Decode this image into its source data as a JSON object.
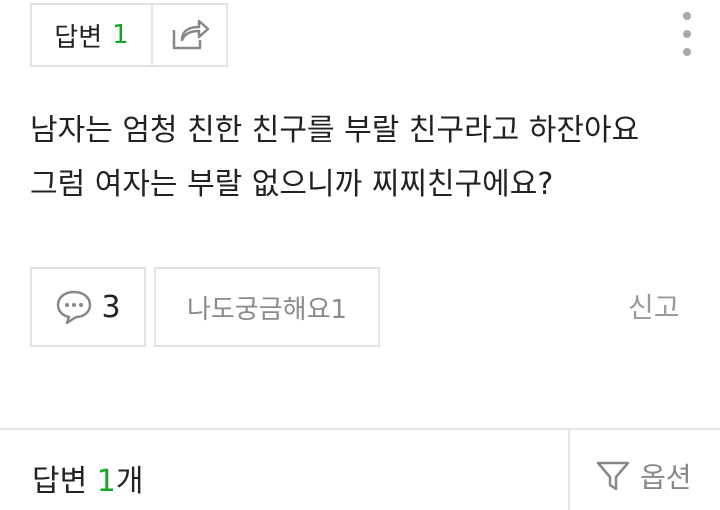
{
  "answer_header": {
    "label": "답변",
    "number": "1"
  },
  "answer": {
    "line1": "남자는 엄청 친한 친구를 부랄 친구라고 하잔아요",
    "line2": "그럼 여자는 부랄 없으니까 찌찌친구에요?"
  },
  "actions": {
    "comment_count": "3",
    "curious_label": "나도궁금해요1",
    "report_label": "신고"
  },
  "footer": {
    "answers_label_prefix": "답변 ",
    "answers_count": "1",
    "answers_label_suffix": "개",
    "option_label": "옵션"
  },
  "icons": {
    "share": "share-icon",
    "more": "more-vertical-icon",
    "comment": "comment-bubble-icon",
    "filter": "filter-icon"
  },
  "colors": {
    "accent_green": "#1aa32a",
    "border": "#e2e2e2",
    "muted_text": "#9a9a9a"
  }
}
